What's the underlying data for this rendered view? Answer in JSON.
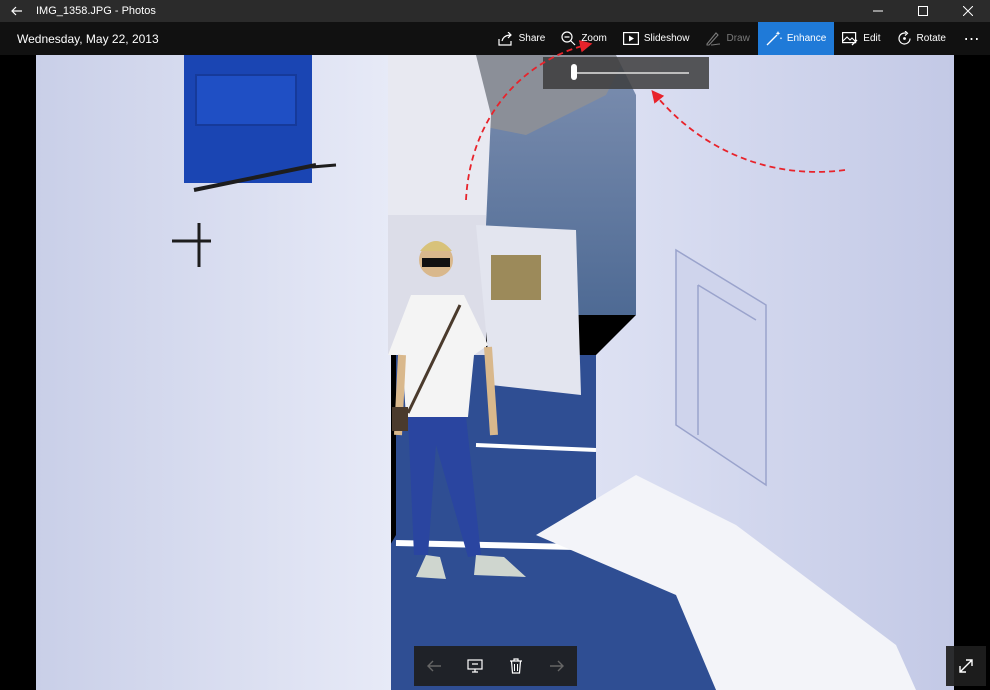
{
  "window": {
    "title": "IMG_1358.JPG - Photos",
    "back_icon": "back-arrow-icon",
    "controls": [
      "minimize-icon",
      "maximize-icon",
      "close-icon"
    ]
  },
  "commandbar": {
    "date": "Wednesday, May 22, 2013",
    "share_label": "Share",
    "zoom_label": "Zoom",
    "slideshow_label": "Slideshow",
    "draw_label": "Draw",
    "enhance_label": "Enhance",
    "edit_label": "Edit",
    "rotate_label": "Rotate",
    "more_label": "⋯"
  },
  "zoom": {
    "level": 0.0
  },
  "colors": {
    "accent": "#1f7ad8",
    "annotation": "#e8232b"
  },
  "bottom_nav": {
    "items": [
      "previous-icon",
      "add-to-album-icon",
      "delete-icon",
      "next-icon"
    ]
  }
}
